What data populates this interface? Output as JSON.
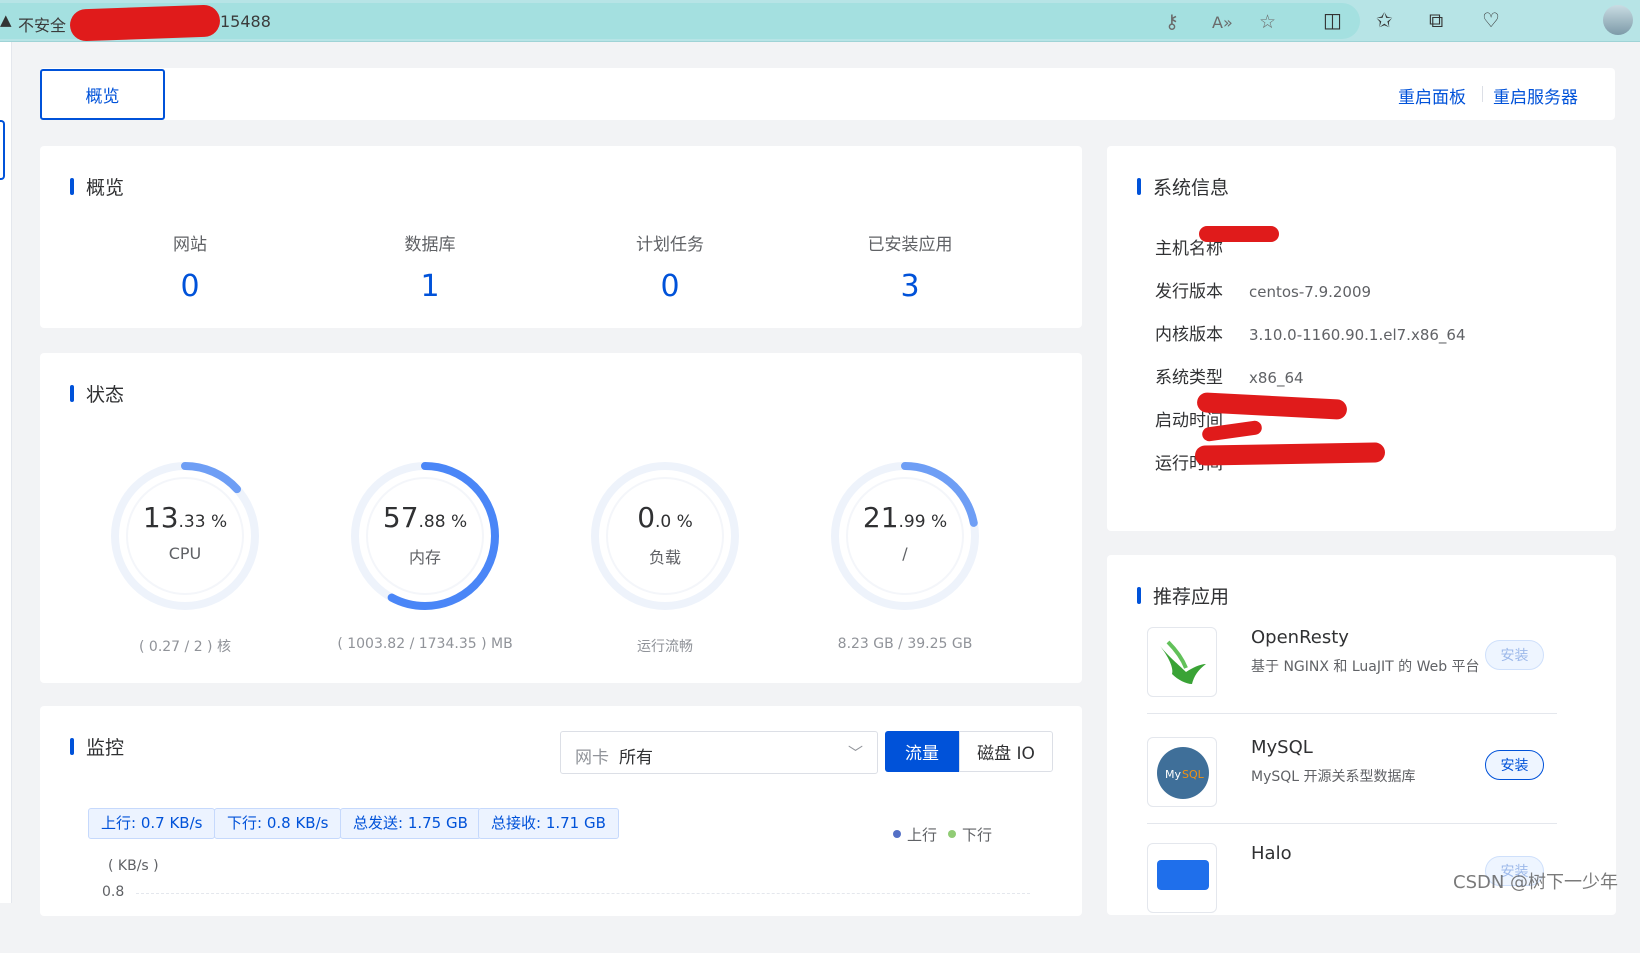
{
  "browser": {
    "warning_label": "不安全",
    "address_suffix": "15488"
  },
  "tabbar": {
    "overview_tab": "概览",
    "restart_panel": "重启面板",
    "restart_server": "重启服务器"
  },
  "overview": {
    "title": "概览",
    "items": [
      {
        "label": "网站",
        "value": "0"
      },
      {
        "label": "数据库",
        "value": "1"
      },
      {
        "label": "计划任务",
        "value": "0"
      },
      {
        "label": "已安装应用",
        "value": "3"
      }
    ]
  },
  "status": {
    "title": "状态",
    "gauges": [
      {
        "int": "13",
        "dec": ".33",
        "unit": " %",
        "label": "CPU",
        "footer": "( 0.27 / 2 ) 核",
        "percent": 13.33
      },
      {
        "int": "57",
        "dec": ".88",
        "unit": " %",
        "label": "内存",
        "footer": "( 1003.82 / 1734.35 ) MB",
        "percent": 57.88
      },
      {
        "int": "0",
        "dec": ".0",
        "unit": " %",
        "label": "负载",
        "footer": "运行流畅",
        "percent": 0
      },
      {
        "int": "21",
        "dec": ".99",
        "unit": " %",
        "label": "/",
        "footer": "8.23 GB / 39.25 GB",
        "percent": 21.99
      }
    ]
  },
  "monitor": {
    "title": "监控",
    "nic_prefix": "网卡",
    "nic_value": "所有",
    "btn_traffic": "流量",
    "btn_disk": "磁盘 IO",
    "tags": [
      "上行: 0.7 KB/s",
      "下行: 0.8 KB/s",
      "总发送: 1.75 GB",
      "总接收: 1.71 GB"
    ],
    "legend_up": "上行",
    "legend_down": "下行",
    "y_unit": "( KB/s )",
    "y_tick": "0.8",
    "colors": {
      "up": "#5470c6",
      "down": "#91cc75"
    }
  },
  "sysinfo": {
    "title": "系统信息",
    "rows": [
      {
        "key": "主机名称",
        "value": ""
      },
      {
        "key": "发行版本",
        "value": "centos-7.9.2009"
      },
      {
        "key": "内核版本",
        "value": "3.10.0-1160.90.1.el7.x86_64"
      },
      {
        "key": "系统类型",
        "value": "x86_64"
      },
      {
        "key": "启动时间",
        "value": ""
      },
      {
        "key": "运行时间",
        "value": ""
      }
    ]
  },
  "recommend": {
    "title": "推荐应用",
    "apps": [
      {
        "name": "OpenResty",
        "desc": "基于 NGINX 和 LuaJIT 的 Web 平台",
        "install": "安装",
        "installable": false
      },
      {
        "name": "MySQL",
        "desc": "MySQL 开源关系型数据库",
        "install": "安装",
        "installable": true
      },
      {
        "name": "Halo",
        "desc": "",
        "install": "安装",
        "installable": false
      }
    ]
  },
  "watermark": "CSDN @树下一少年",
  "accent": "#0052d9"
}
